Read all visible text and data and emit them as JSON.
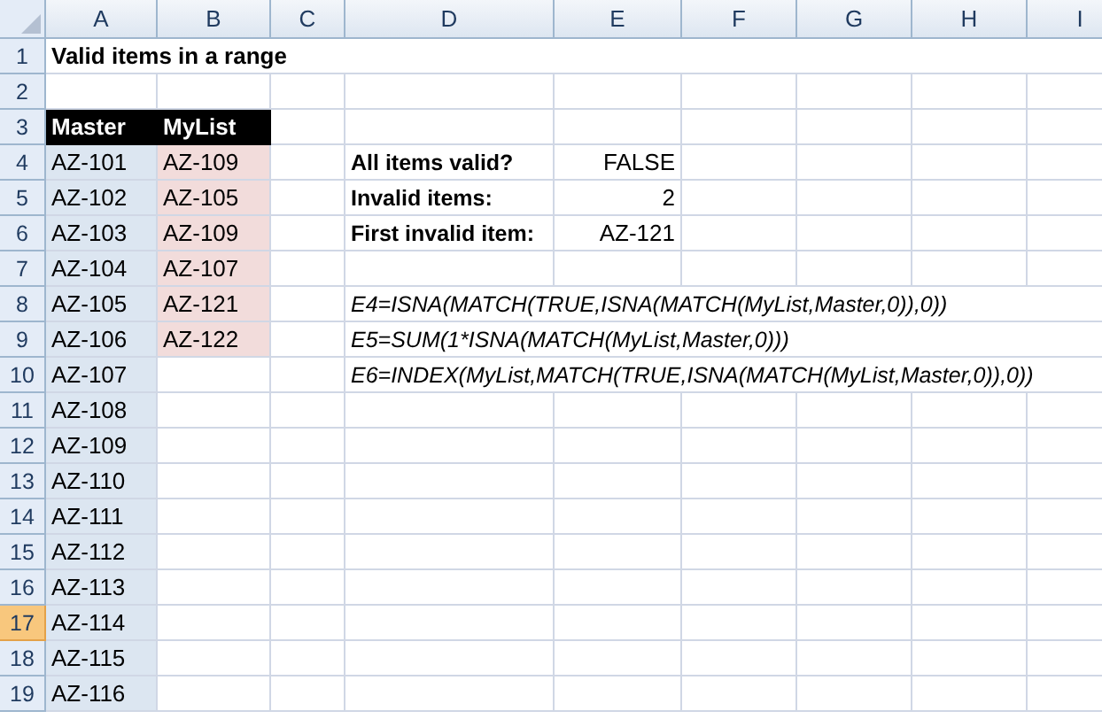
{
  "columns": [
    {
      "label": "A",
      "selected": false
    },
    {
      "label": "B",
      "selected": false
    },
    {
      "label": "C",
      "selected": false
    },
    {
      "label": "D",
      "selected": false
    },
    {
      "label": "E",
      "selected": false
    },
    {
      "label": "F",
      "selected": false
    },
    {
      "label": "G",
      "selected": false
    },
    {
      "label": "H",
      "selected": false
    },
    {
      "label": "I",
      "selected": false
    }
  ],
  "rows": [
    {
      "number": "1",
      "selected": false,
      "cells": [
        {
          "kind": "title",
          "text": "Valid items in a range"
        }
      ]
    },
    {
      "number": "2",
      "selected": false
    },
    {
      "number": "3",
      "selected": false,
      "cells": [
        {
          "kind": "header",
          "text": "Master"
        },
        {
          "kind": "header",
          "text": "MyList"
        }
      ]
    },
    {
      "number": "4",
      "selected": false,
      "cells": [
        {
          "kind": "master",
          "text": "AZ-101"
        },
        {
          "kind": "mylist",
          "text": "AZ-109"
        },
        {
          "kind": "blank"
        },
        {
          "kind": "label",
          "text": "All items valid?"
        },
        {
          "kind": "value",
          "text": "FALSE"
        }
      ]
    },
    {
      "number": "5",
      "selected": false,
      "cells": [
        {
          "kind": "master",
          "text": "AZ-102"
        },
        {
          "kind": "mylist",
          "text": "AZ-105"
        },
        {
          "kind": "blank"
        },
        {
          "kind": "label",
          "text": "Invalid items:"
        },
        {
          "kind": "value",
          "text": "2"
        }
      ]
    },
    {
      "number": "6",
      "selected": false,
      "cells": [
        {
          "kind": "master",
          "text": "AZ-103"
        },
        {
          "kind": "mylist",
          "text": "AZ-109"
        },
        {
          "kind": "blank"
        },
        {
          "kind": "label",
          "text": "First invalid item:"
        },
        {
          "kind": "value",
          "text": "AZ-121"
        }
      ]
    },
    {
      "number": "7",
      "selected": false,
      "cells": [
        {
          "kind": "master",
          "text": "AZ-104"
        },
        {
          "kind": "mylist",
          "text": "AZ-107"
        }
      ]
    },
    {
      "number": "8",
      "selected": false,
      "cells": [
        {
          "kind": "master",
          "text": "AZ-105"
        },
        {
          "kind": "mylist",
          "text": "AZ-121"
        },
        {
          "kind": "blank"
        },
        {
          "kind": "formula",
          "text": "E4=ISNA(MATCH(TRUE,ISNA(MATCH(MyList,Master,0)),0))"
        }
      ]
    },
    {
      "number": "9",
      "selected": false,
      "cells": [
        {
          "kind": "master",
          "text": "AZ-106"
        },
        {
          "kind": "mylist",
          "text": "AZ-122"
        },
        {
          "kind": "blank"
        },
        {
          "kind": "formula",
          "text": "E5=SUM(1*ISNA(MATCH(MyList,Master,0)))"
        }
      ]
    },
    {
      "number": "10",
      "selected": false,
      "cells": [
        {
          "kind": "master",
          "text": "AZ-107"
        },
        {
          "kind": "blank"
        },
        {
          "kind": "blank"
        },
        {
          "kind": "formula",
          "text": "E6=INDEX(MyList,MATCH(TRUE,ISNA(MATCH(MyList,Master,0)),0))"
        }
      ]
    },
    {
      "number": "11",
      "selected": false,
      "cells": [
        {
          "kind": "master",
          "text": "AZ-108"
        }
      ]
    },
    {
      "number": "12",
      "selected": false,
      "cells": [
        {
          "kind": "master",
          "text": "AZ-109"
        }
      ]
    },
    {
      "number": "13",
      "selected": false,
      "cells": [
        {
          "kind": "master",
          "text": "AZ-110"
        }
      ]
    },
    {
      "number": "14",
      "selected": false,
      "cells": [
        {
          "kind": "master",
          "text": "AZ-111"
        }
      ]
    },
    {
      "number": "15",
      "selected": false,
      "cells": [
        {
          "kind": "master",
          "text": "AZ-112"
        }
      ]
    },
    {
      "number": "16",
      "selected": false,
      "cells": [
        {
          "kind": "master",
          "text": "AZ-113"
        }
      ]
    },
    {
      "number": "17",
      "selected": true,
      "cells": [
        {
          "kind": "master",
          "text": "AZ-114"
        }
      ]
    },
    {
      "number": "18",
      "selected": false,
      "cells": [
        {
          "kind": "master",
          "text": "AZ-115"
        }
      ]
    },
    {
      "number": "19",
      "selected": false,
      "cells": [
        {
          "kind": "master",
          "text": "AZ-116"
        }
      ]
    }
  ]
}
